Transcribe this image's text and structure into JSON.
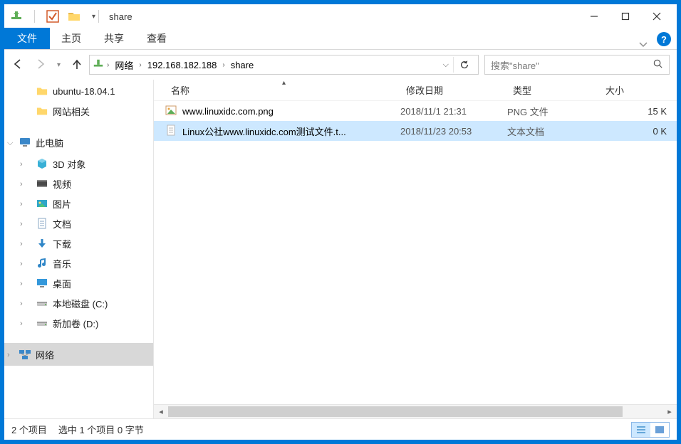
{
  "window": {
    "title": "share"
  },
  "ribbon": {
    "file": "文件",
    "tabs": [
      "主页",
      "共享",
      "查看"
    ]
  },
  "nav": {
    "crumbs": [
      "网络",
      "192.168.182.188",
      "share"
    ]
  },
  "search": {
    "placeholder": "搜索\"share\""
  },
  "tree": {
    "quick": [
      {
        "label": "ubuntu-18.04.1"
      },
      {
        "label": "网站相关"
      }
    ],
    "this_pc": {
      "label": "此电脑",
      "children": [
        {
          "label": "3D 对象",
          "icon": "3d"
        },
        {
          "label": "视频",
          "icon": "video"
        },
        {
          "label": "图片",
          "icon": "pictures"
        },
        {
          "label": "文档",
          "icon": "docs"
        },
        {
          "label": "下载",
          "icon": "downloads"
        },
        {
          "label": "音乐",
          "icon": "music"
        },
        {
          "label": "桌面",
          "icon": "desktop"
        },
        {
          "label": "本地磁盘 (C:)",
          "icon": "drive"
        },
        {
          "label": "新加卷 (D:)",
          "icon": "drive"
        }
      ]
    },
    "network": {
      "label": "网络"
    }
  },
  "columns": {
    "name": "名称",
    "date": "修改日期",
    "type": "类型",
    "size": "大小"
  },
  "rows": [
    {
      "name": "www.linuxidc.com.png",
      "date": "2018/11/1 21:31",
      "type": "PNG 文件",
      "size": "15 K",
      "icon": "png",
      "selected": false
    },
    {
      "name": "Linux公社www.linuxidc.com测试文件.t...",
      "date": "2018/11/23 20:53",
      "type": "文本文档",
      "size": "0 K",
      "icon": "txt",
      "selected": true
    }
  ],
  "status": {
    "items": "2 个项目",
    "selection": "选中 1 个项目 0 字节"
  }
}
